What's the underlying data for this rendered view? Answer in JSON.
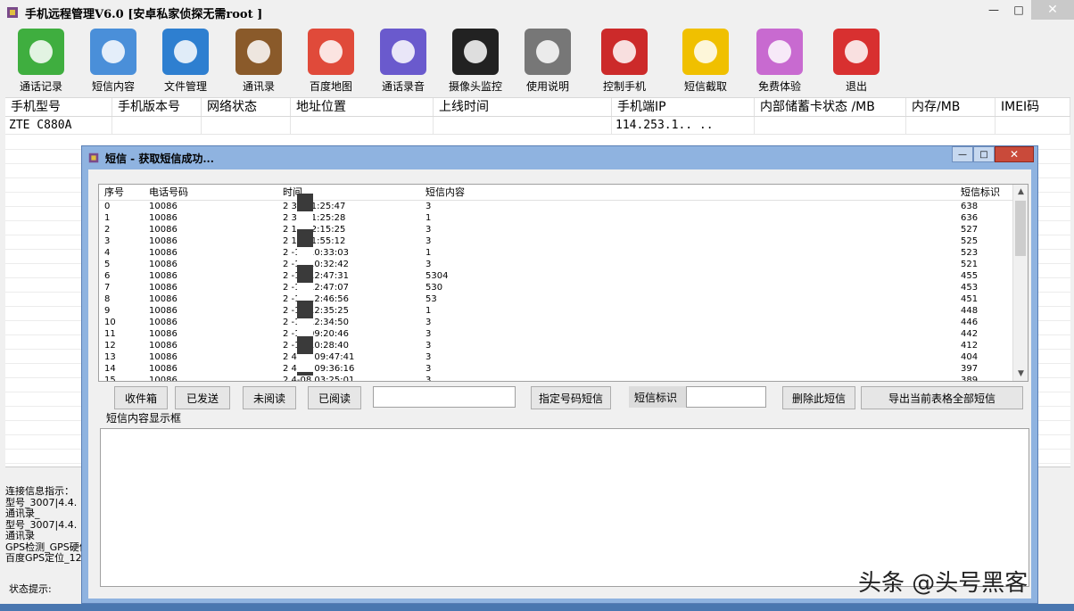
{
  "window": {
    "title": "手机远程管理V6.0 [安卓私家侦探无需root ]",
    "minimize": "—",
    "maximize": "□",
    "close": "✕"
  },
  "toolbar": [
    {
      "label": "通话记录",
      "icon": "phone-icon",
      "color": "#3fae3f"
    },
    {
      "label": "短信内容",
      "icon": "mail-icon",
      "color": "#4a8fd9"
    },
    {
      "label": "文件管理",
      "icon": "file-cabinet-icon",
      "color": "#2e7fd0"
    },
    {
      "label": "通讯录",
      "icon": "address-book-icon",
      "color": "#8a5a2a"
    },
    {
      "label": "百度地图",
      "icon": "baidu-map-icon",
      "color": "#e04a3a"
    },
    {
      "label": "通话录音",
      "icon": "microphone-icon",
      "color": "#6a5acd"
    },
    {
      "label": "摄像头监控",
      "icon": "camera-icon",
      "color": "#222222"
    },
    {
      "label": "使用说明",
      "icon": "settings-icon",
      "color": "#777777"
    },
    {
      "label": "控制手机",
      "icon": "building-icon",
      "color": "#cc2a2a"
    },
    {
      "label": "短信截取",
      "icon": "ferrari-icon",
      "color": "#f0c000"
    },
    {
      "label": "免费体验",
      "icon": "game-center-icon",
      "color": "#c86ad0"
    },
    {
      "label": "退出",
      "icon": "power-icon",
      "color": "#d83030"
    }
  ],
  "grid": {
    "columns": [
      "手机型号",
      "手机版本号",
      "网络状态",
      "地址位置",
      "上线时间",
      "手机端IP",
      "内部储蓄卡状态 /MB",
      "内存/MB",
      "IMEI码"
    ],
    "row": [
      "ZTE C880A",
      "",
      "",
      "",
      "",
      "114.253.1.. ..",
      "",
      "",
      ""
    ]
  },
  "log": {
    "lines": [
      "连接信息指示：",
      "型号_3007|4.4.",
      "通讯录_",
      "型号_3007|4.4.",
      "通讯录",
      "GPS检测_GPS硬件",
      "百度GPS定位_12"
    ]
  },
  "status": {
    "label": "状态提示:"
  },
  "dialog": {
    "title": "短信 - 获取短信成功...",
    "columns": [
      "序号",
      "电话号码",
      "时间",
      "短信内容",
      "短信标识"
    ],
    "rows": [
      {
        "n": "0",
        "phone": "10086",
        "time": "2 30 01:25:47",
        "content": "3",
        "id": "638"
      },
      {
        "n": "1",
        "phone": "10086",
        "time": "2 30 01:25:28",
        "content": "1",
        "id": "636"
      },
      {
        "n": "2",
        "phone": "10086",
        "time": "2 13 02:15:25",
        "content": "3",
        "id": "527"
      },
      {
        "n": "3",
        "phone": "10086",
        "time": "2 13 01:55:12",
        "content": "3",
        "id": "525"
      },
      {
        "n": "4",
        "phone": "10086",
        "time": "2 -13 10:33:03",
        "content": "1",
        "id": "523"
      },
      {
        "n": "5",
        "phone": "10086",
        "time": "2 -13 10:32:42",
        "content": "3",
        "id": "521"
      },
      {
        "n": "6",
        "phone": "10086",
        "time": "2 -18 12:47:31",
        "content": "5304",
        "id": "455"
      },
      {
        "n": "7",
        "phone": "10086",
        "time": "2 -18 12:47:07",
        "content": "530",
        "id": "453"
      },
      {
        "n": "8",
        "phone": "10086",
        "time": "2 -18 12:46:56",
        "content": "53",
        "id": "451"
      },
      {
        "n": "9",
        "phone": "10086",
        "time": "2 -18 12:35:25",
        "content": "1",
        "id": "448"
      },
      {
        "n": "10",
        "phone": "10086",
        "time": "2 -18 12:34:50",
        "content": "3",
        "id": "446"
      },
      {
        "n": "11",
        "phone": "10086",
        "time": "2 -18 09:20:46",
        "content": "3",
        "id": "442"
      },
      {
        "n": "12",
        "phone": "10086",
        "time": "2 -13 10:28:40",
        "content": "3",
        "id": "412"
      },
      {
        "n": "13",
        "phone": "10086",
        "time": "2 4-12 09:47:41",
        "content": "3",
        "id": "404"
      },
      {
        "n": "14",
        "phone": "10086",
        "time": "2 4-11 09:36:16",
        "content": "3",
        "id": "397"
      },
      {
        "n": "15",
        "phone": "10086",
        "time": "2 4-08 03:25:01",
        "content": "3",
        "id": "389"
      }
    ],
    "buttons": {
      "inbox": "收件箱",
      "sent": "已发送",
      "unread": "未阅读",
      "read": "已阅读",
      "by_number": "指定号码短信",
      "sms_id_label": "短信标识",
      "delete": "删除此短信",
      "export": "导出当前表格全部短信"
    },
    "content_group": "短信内容显示框"
  },
  "watermark": "头条 @头号黑客"
}
